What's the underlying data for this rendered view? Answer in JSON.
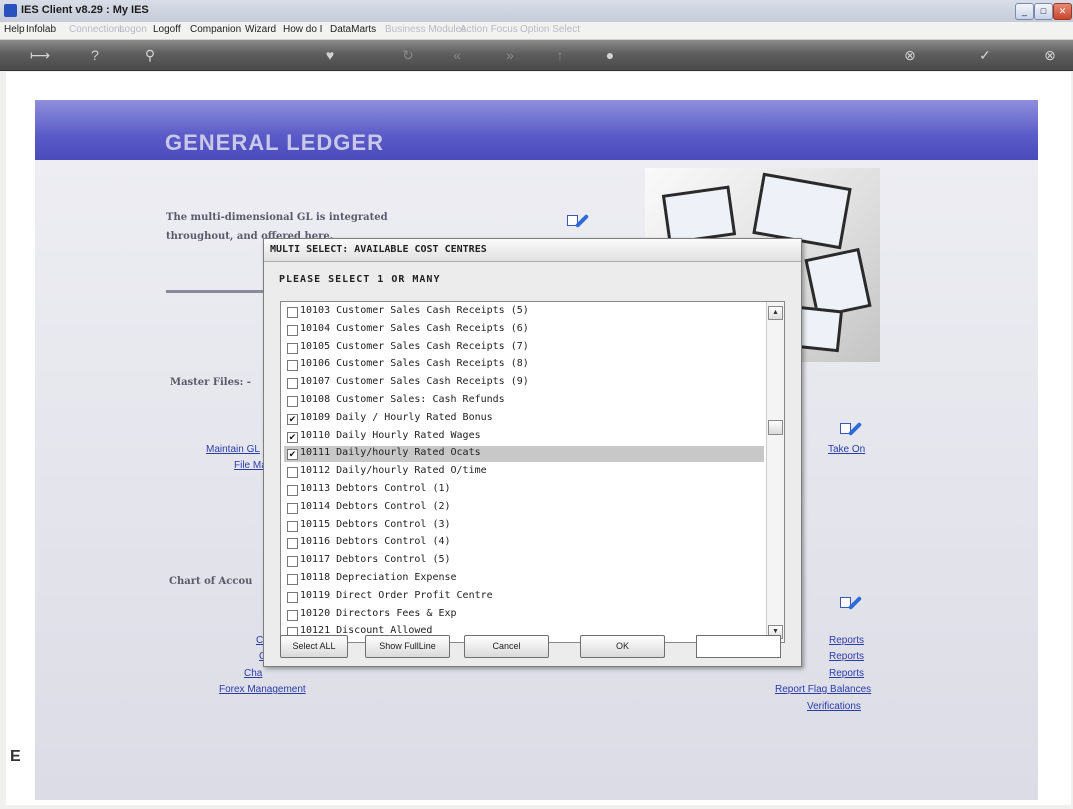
{
  "window": {
    "title": "IES Client v8.29 : My IES"
  },
  "menubar": {
    "items": [
      {
        "label": "Help",
        "enabled": true
      },
      {
        "label": "Infolab",
        "enabled": true
      },
      {
        "label": "Connections",
        "enabled": false
      },
      {
        "label": "Logon",
        "enabled": false
      },
      {
        "label": "Logoff",
        "enabled": true
      },
      {
        "label": "Companion",
        "enabled": true
      },
      {
        "label": "Wizard",
        "enabled": true
      },
      {
        "label": "How do I",
        "enabled": true
      },
      {
        "label": "DataMarts",
        "enabled": true
      },
      {
        "label": "Business Modules",
        "enabled": false
      },
      {
        "label": "Action Focus",
        "enabled": false
      },
      {
        "label": "Option Select",
        "enabled": false
      }
    ]
  },
  "toolbar": {
    "icons": [
      "exit-arrow-icon",
      "help-icon",
      "search-icon",
      "heart-icon",
      "refresh-icon",
      "back-icon",
      "forward-icon",
      "up-icon",
      "bullet-icon",
      "cancel-icon",
      "confirm-icon",
      "close-icon"
    ]
  },
  "page": {
    "banner_title": "GENERAL LEDGER",
    "intro_text": "The multi-dimensional GL is integrated throughout, and offered here.",
    "sections": {
      "master_files": "Master Files: -",
      "chart_of_accounts": "Chart of Accou"
    },
    "links": {
      "maintain": "Maintain GL",
      "file_ma": "File Ma",
      "take_on": "Take On",
      "cc": "CC",
      "c": "C",
      "cha": "Cha",
      "forex": "Forex Management",
      "reports1": "Reports",
      "reports2": "Reports",
      "reports3": "Reports",
      "report_flag": "Report Flag Balances",
      "verifications": "Verifications"
    }
  },
  "dialog": {
    "title": "MULTI SELECT: AVAILABLE COST CENTRES",
    "prompt": "PLEASE SELECT 1 OR MANY",
    "items": [
      {
        "label": "10103 Customer Sales Cash Receipts (5)",
        "checked": false,
        "selected": false
      },
      {
        "label": "10104 Customer Sales Cash Receipts (6)",
        "checked": false,
        "selected": false
      },
      {
        "label": "10105 Customer Sales Cash Receipts (7)",
        "checked": false,
        "selected": false
      },
      {
        "label": "10106 Customer Sales Cash Receipts (8)",
        "checked": false,
        "selected": false
      },
      {
        "label": "10107 Customer Sales Cash Receipts (9)",
        "checked": false,
        "selected": false
      },
      {
        "label": "10108 Customer Sales: Cash Refunds",
        "checked": false,
        "selected": false
      },
      {
        "label": "10109 Daily / Hourly Rated Bonus",
        "checked": true,
        "selected": false
      },
      {
        "label": "10110 Daily Hourly Rated Wages",
        "checked": true,
        "selected": false
      },
      {
        "label": "10111 Daily/hourly Rated Ocats",
        "checked": true,
        "selected": true
      },
      {
        "label": "10112 Daily/hourly Rated O/time",
        "checked": false,
        "selected": false
      },
      {
        "label": "10113 Debtors Control (1)",
        "checked": false,
        "selected": false
      },
      {
        "label": "10114 Debtors Control (2)",
        "checked": false,
        "selected": false
      },
      {
        "label": "10115 Debtors Control (3)",
        "checked": false,
        "selected": false
      },
      {
        "label": "10116 Debtors Control (4)",
        "checked": false,
        "selected": false
      },
      {
        "label": "10117 Debtors Control (5)",
        "checked": false,
        "selected": false
      },
      {
        "label": "10118 Depreciation Expense",
        "checked": false,
        "selected": false
      },
      {
        "label": "10119 Direct Order Profit Centre",
        "checked": false,
        "selected": false
      },
      {
        "label": "10120 Directors Fees & Exp",
        "checked": false,
        "selected": false
      },
      {
        "label": "10121 Discount Allowed",
        "checked": false,
        "selected": false
      }
    ],
    "buttons": {
      "select_all": "Select ALL",
      "show_full_line": "Show FullLine",
      "cancel": "Cancel",
      "ok": "OK"
    },
    "input_value": ""
  }
}
